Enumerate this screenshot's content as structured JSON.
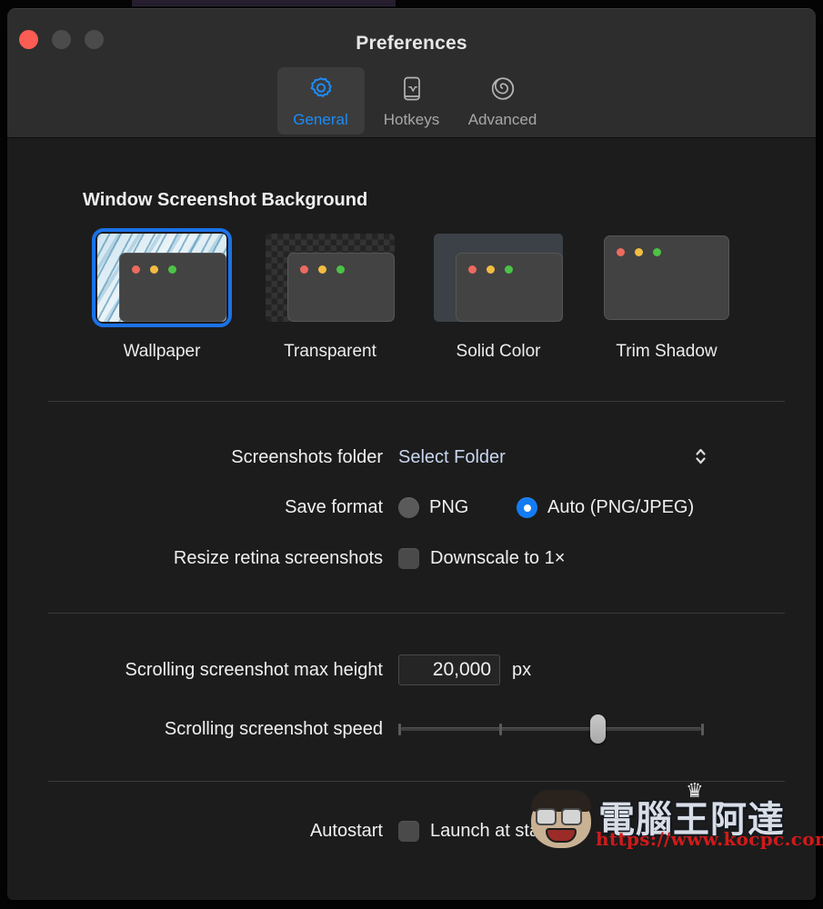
{
  "window": {
    "title": "Preferences",
    "traffic_lights": [
      "close",
      "minimize",
      "maximize"
    ]
  },
  "toolbar": {
    "tabs": [
      {
        "label": "General",
        "icon": "gear-icon",
        "active": true
      },
      {
        "label": "Hotkeys",
        "icon": "keyboard-icon",
        "active": false
      },
      {
        "label": "Advanced",
        "icon": "spiral-icon",
        "active": false
      }
    ]
  },
  "background_section": {
    "title": "Window Screenshot Background",
    "options": [
      {
        "label": "Wallpaper",
        "selected": true
      },
      {
        "label": "Transparent",
        "selected": false
      },
      {
        "label": "Solid Color",
        "selected": false
      },
      {
        "label": "Trim Shadow",
        "selected": false
      }
    ]
  },
  "settings": {
    "screenshots_folder": {
      "label": "Screenshots folder",
      "value": "Select Folder",
      "chevrons": "⌃⌄"
    },
    "save_format": {
      "label": "Save format",
      "options": [
        {
          "label": "PNG",
          "checked": false
        },
        {
          "label": "Auto (PNG/JPEG)",
          "checked": true
        }
      ]
    },
    "resize_retina": {
      "label": "Resize retina screenshots",
      "checkbox_label": "Downscale to 1×",
      "checked": false
    },
    "max_height": {
      "label": "Scrolling screenshot max height",
      "value": "20,000",
      "unit": "px"
    },
    "speed": {
      "label": "Scrolling screenshot speed",
      "value_percent": 65,
      "tick_percents": [
        0,
        33,
        100
      ]
    },
    "autostart": {
      "label": "Autostart",
      "checkbox_label": "Launch at startup",
      "checked": false
    }
  },
  "watermark": {
    "brand": "電腦王阿達",
    "url": "https://www.kocpc.com.tw",
    "crown": "♛"
  },
  "colors": {
    "accent": "#137cf3",
    "selection_border": "#1b72e8",
    "window_bg": "#1c1c1c",
    "titlebar_bg": "#2d2d2d",
    "close_red": "#fb5c54",
    "watermark_red": "#d01a1a"
  }
}
